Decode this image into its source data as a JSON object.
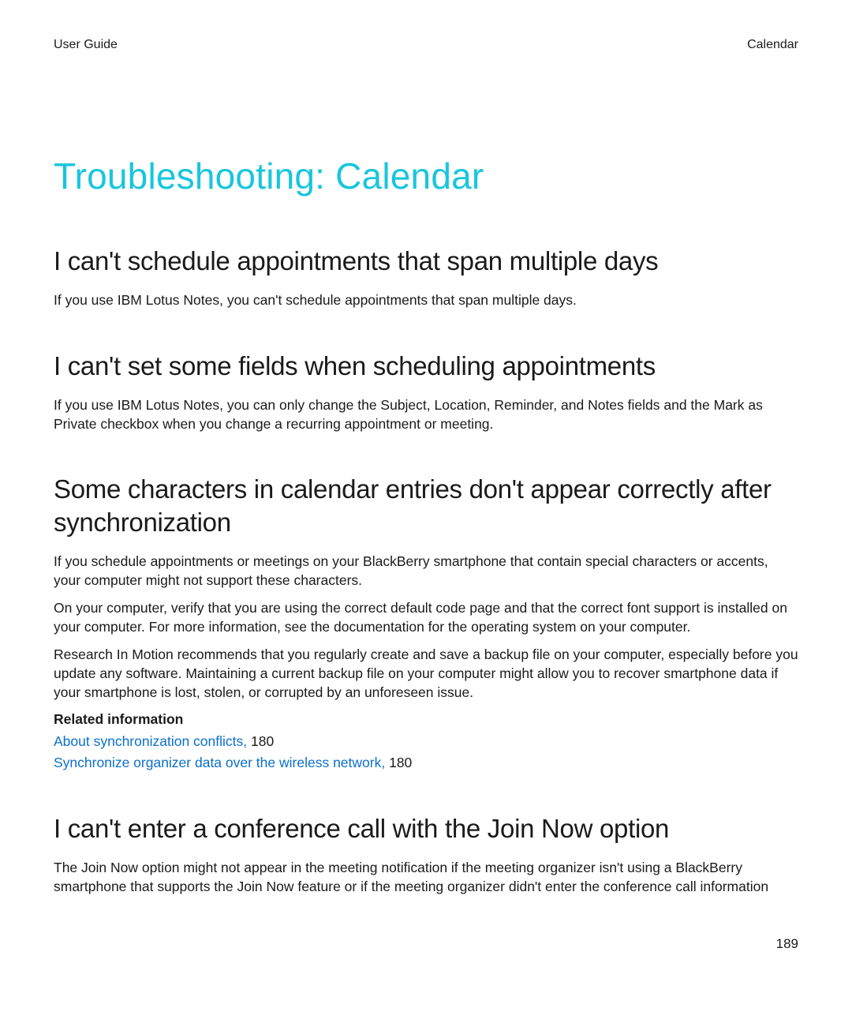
{
  "header": {
    "left": "User Guide",
    "right": "Calendar"
  },
  "title": "Troubleshooting: Calendar",
  "sections": [
    {
      "heading": "I can't schedule appointments that span multiple days",
      "paragraphs": [
        "If you use IBM Lotus Notes, you can't schedule appointments that span multiple days."
      ]
    },
    {
      "heading": "I can't set some fields when scheduling appointments",
      "paragraphs": [
        "If you use IBM Lotus Notes, you can only change the Subject, Location, Reminder, and Notes fields and the Mark as Private checkbox when you change a recurring appointment or meeting."
      ]
    },
    {
      "heading": "Some characters in calendar entries don't appear correctly after synchronization",
      "paragraphs": [
        "If you schedule appointments or meetings on your BlackBerry smartphone that contain special characters or accents, your computer might not support these characters.",
        "On your computer, verify that you are using the correct default code page and that the correct font support is installed on your computer. For more information, see the documentation for the operating system on your computer.",
        "Research In Motion recommends that you regularly create and save a backup file on your computer, especially before you update any software. Maintaining a current backup file on your computer might allow you to recover smartphone data if your smartphone is lost, stolen, or corrupted by an unforeseen issue."
      ],
      "related": {
        "label": "Related information",
        "links": [
          {
            "text": "About synchronization conflicts,",
            "page": "180"
          },
          {
            "text": "Synchronize organizer data over the wireless network,",
            "page": "180"
          }
        ]
      }
    },
    {
      "heading": "I can't enter a conference call with the Join Now option",
      "paragraphs": [
        "The Join Now option might not appear in the meeting notification if the meeting organizer isn't using a BlackBerry smartphone that supports the Join Now feature or if the meeting organizer didn't enter the conference call information"
      ]
    }
  ],
  "page_number": "189"
}
